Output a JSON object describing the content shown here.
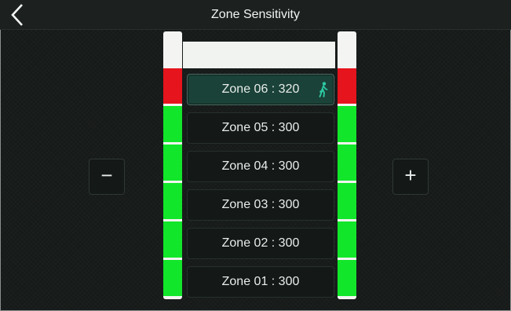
{
  "header": {
    "title": "Zone Sensitivity",
    "back_icon": "chevron-left-icon"
  },
  "controls": {
    "decrease_label": "−",
    "increase_label": "+",
    "decrease_icon": "minus-icon",
    "increase_icon": "plus-icon"
  },
  "colors": {
    "alarm_red": "#e6141c",
    "ok_green": "#12e62a",
    "active_teal": "#1a4238",
    "walker": "#2ecaa4"
  },
  "zones": [
    {
      "label": "Zone 06 : 320",
      "selected": true,
      "motion_icon": "walking-person-icon",
      "level": "red"
    },
    {
      "label": "Zone 05 : 300",
      "selected": false,
      "level": "green"
    },
    {
      "label": "Zone 04 : 300",
      "selected": false,
      "level": "green"
    },
    {
      "label": "Zone 03 : 300",
      "selected": false,
      "level": "green"
    },
    {
      "label": "Zone 02 : 300",
      "selected": false,
      "level": "green"
    },
    {
      "label": "Zone 01 : 300",
      "selected": false,
      "level": "green"
    }
  ]
}
